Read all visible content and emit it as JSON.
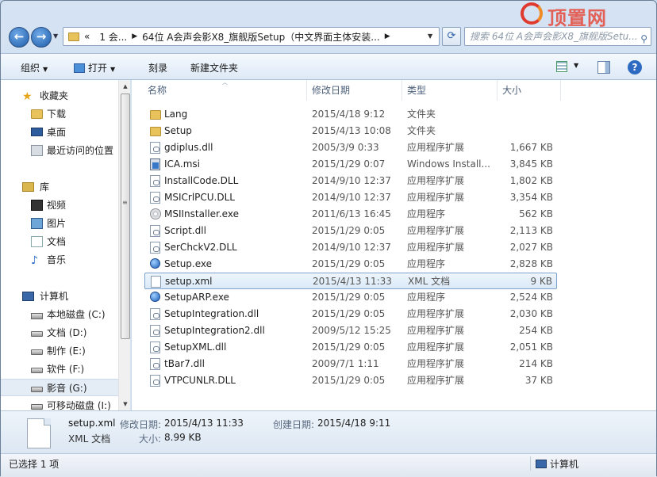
{
  "address": {
    "path_prefix": "«",
    "crumbs": [
      "1 会...",
      "64位 A会声会影X8_旗舰版Setup（中文界面主体安装..."
    ],
    "search_placeholder": "搜索 64位 A会声会影X8_旗舰版Setu..."
  },
  "logo": {
    "text": "顶置网"
  },
  "toolbar": {
    "organize": "组织",
    "open": "打开",
    "burn": "刻录",
    "new_folder": "新建文件夹"
  },
  "sidebar": {
    "favorites": "收藏夹",
    "fav_items": [
      "下载",
      "桌面",
      "最近访问的位置"
    ],
    "libraries": "库",
    "lib_items": [
      "视频",
      "图片",
      "文档",
      "音乐"
    ],
    "computer": "计算机",
    "drives": [
      "本地磁盘 (C:)",
      "文档 (D:)",
      "制作 (E:)",
      "软件 (F:)",
      "影音 (G:)",
      "可移动磁盘 (I:)"
    ]
  },
  "columns": {
    "name": "名称",
    "date": "修改日期",
    "type": "类型",
    "size": "大小"
  },
  "files": [
    {
      "name": "Lang",
      "date": "2015/4/18 9:12",
      "type": "文件夹",
      "size": "",
      "icon": "folder-icon"
    },
    {
      "name": "Setup",
      "date": "2015/4/13 10:08",
      "type": "文件夹",
      "size": "",
      "icon": "folder-icon"
    },
    {
      "name": "gdiplus.dll",
      "date": "2005/3/9 0:33",
      "type": "应用程序扩展",
      "size": "1,667 KB",
      "icon": "dll-icon"
    },
    {
      "name": "ICA.msi",
      "date": "2015/1/29 0:07",
      "type": "Windows Install...",
      "size": "3,845 KB",
      "icon": "msi-icon"
    },
    {
      "name": "InstallCode.DLL",
      "date": "2014/9/10 12:37",
      "type": "应用程序扩展",
      "size": "1,802 KB",
      "icon": "dll-icon"
    },
    {
      "name": "MSICrlPCU.DLL",
      "date": "2014/9/10 12:37",
      "type": "应用程序扩展",
      "size": "3,354 KB",
      "icon": "dll-icon"
    },
    {
      "name": "MSIInstaller.exe",
      "date": "2011/6/13 16:45",
      "type": "应用程序",
      "size": "562 KB",
      "icon": "disc-exe-icon"
    },
    {
      "name": "Script.dll",
      "date": "2015/1/29 0:05",
      "type": "应用程序扩展",
      "size": "2,113 KB",
      "icon": "dll-icon"
    },
    {
      "name": "SerChckV2.DLL",
      "date": "2014/9/10 12:37",
      "type": "应用程序扩展",
      "size": "2,027 KB",
      "icon": "dll-icon"
    },
    {
      "name": "Setup.exe",
      "date": "2015/1/29 0:05",
      "type": "应用程序",
      "size": "2,828 KB",
      "icon": "globe-exe-icon"
    },
    {
      "name": "setup.xml",
      "date": "2015/4/13 11:33",
      "type": "XML 文档",
      "size": "9 KB",
      "icon": "xml-icon"
    },
    {
      "name": "SetupARP.exe",
      "date": "2015/1/29 0:05",
      "type": "应用程序",
      "size": "2,524 KB",
      "icon": "globe-exe-icon"
    },
    {
      "name": "SetupIntegration.dll",
      "date": "2015/1/29 0:05",
      "type": "应用程序扩展",
      "size": "2,030 KB",
      "icon": "dll-icon"
    },
    {
      "name": "SetupIntegration2.dll",
      "date": "2009/5/12 15:25",
      "type": "应用程序扩展",
      "size": "254 KB",
      "icon": "dll-icon"
    },
    {
      "name": "SetupXML.dll",
      "date": "2015/1/29 0:05",
      "type": "应用程序扩展",
      "size": "2,051 KB",
      "icon": "dll-icon"
    },
    {
      "name": "tBar7.dll",
      "date": "2009/7/1 1:11",
      "type": "应用程序扩展",
      "size": "214 KB",
      "icon": "dll-icon"
    },
    {
      "name": "VTPCUNLR.DLL",
      "date": "2015/1/29 0:05",
      "type": "应用程序扩展",
      "size": "37 KB",
      "icon": "dll-icon"
    }
  ],
  "selected_file": "setup.xml",
  "details": {
    "name": "setup.xml",
    "type": "XML 文档",
    "modified_label": "修改日期:",
    "modified_value": "2015/4/13 11:33",
    "created_label": "创建日期:",
    "created_value": "2015/4/18 9:11",
    "size_label": "大小:",
    "size_value": "8.99 KB"
  },
  "status": {
    "left": "已选择 1 项",
    "right": "计算机"
  },
  "colors": {
    "selection_border": "#7da2ce",
    "selection_bg": "#dbe9f8",
    "link_blue": "#2d6bc2"
  }
}
